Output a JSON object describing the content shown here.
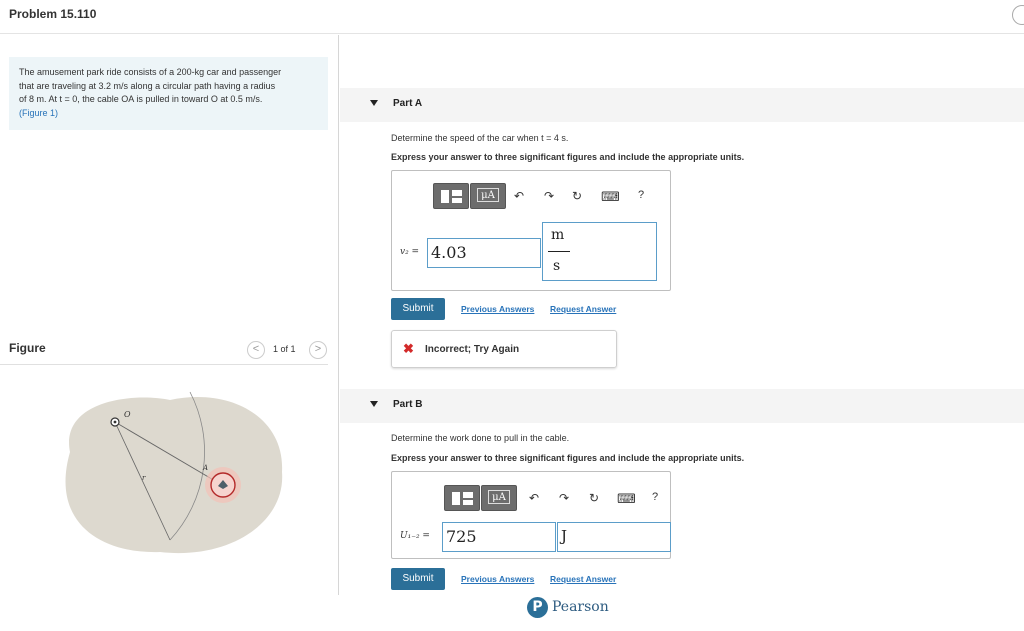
{
  "header": {
    "title": "Problem 15.110"
  },
  "statement": {
    "line1": "The amusement park ride consists of a 200-kg car and passenger",
    "line2": "that are traveling at 3.2 m/s along a circular path having a radius",
    "line3": "of 8 m. At t = 0, the cable OA is pulled in toward O at 0.5 m/s.",
    "figure_link": "(Figure 1)"
  },
  "figure": {
    "label": "Figure",
    "pager": "1 of 1",
    "prev_glyph": "<",
    "next_glyph": ">",
    "point_o": "O",
    "point_a": "A",
    "radius_label": "r"
  },
  "part_a": {
    "title": "Part A",
    "question": "Determine the speed of the car when t = 4 s.",
    "instruction": "Express your answer to three significant figures and include the appropriate units.",
    "mu_label": "μA",
    "help_label": "?",
    "var_label": "v₂ =",
    "value": "4.03",
    "unit_num": "m",
    "unit_den": "s",
    "submit_label": "Submit",
    "prev_answers": "Previous Answers",
    "request_answer": "Request Answer",
    "feedback_icon": "✖",
    "feedback_text": "Incorrect; Try Again"
  },
  "part_b": {
    "title": "Part B",
    "question": "Determine the work done to pull in the cable.",
    "instruction": "Express your answer to three significant figures and include the appropriate units.",
    "mu_label": "μA",
    "help_label": "?",
    "var_label": "U₁₋₂ =",
    "value": "725",
    "unit": "J",
    "submit_label": "Submit",
    "prev_answers": "Previous Answers",
    "request_answer": "Request Answer"
  },
  "footer": {
    "brand": "Pearson",
    "logo_letter": "P"
  },
  "toolbar": {
    "undo": "↶",
    "redo": "↷",
    "reset": "↻",
    "keyboard": "⌨"
  },
  "colors": {
    "accent": "#2b6f98",
    "link": "#2873b9",
    "error": "#d32a2a",
    "statement_bg": "#edf5f8"
  }
}
